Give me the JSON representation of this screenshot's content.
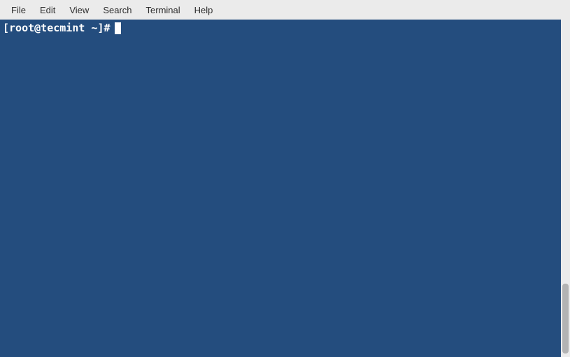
{
  "menubar": {
    "items": [
      {
        "label": "File"
      },
      {
        "label": "Edit"
      },
      {
        "label": "View"
      },
      {
        "label": "Search"
      },
      {
        "label": "Terminal"
      },
      {
        "label": "Help"
      }
    ]
  },
  "terminal": {
    "prompt": "[root@tecmint ~]#",
    "input": ""
  }
}
